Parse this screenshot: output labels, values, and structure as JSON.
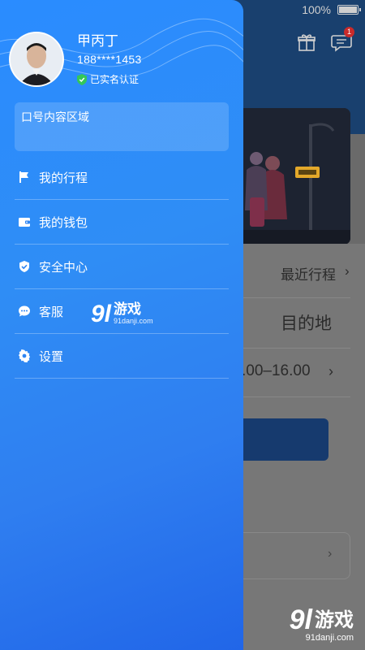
{
  "status_bar": {
    "battery_text": "100%"
  },
  "header": {
    "message_badge": "1"
  },
  "background": {
    "recent_trips_label": "最近行程",
    "recent_chevron": "›",
    "destination_label": "目的地",
    "time_range": ".00–16.00",
    "time_chevron": "›",
    "card_chevron": "›"
  },
  "drawer": {
    "user": {
      "name": "甲丙丁",
      "phone": "188****1453",
      "verified_label": "已实名认证"
    },
    "content_placeholder": "口号内容区域",
    "menu": [
      {
        "label": "我的行程",
        "icon": "flag-icon"
      },
      {
        "label": "我的钱包",
        "icon": "wallet-icon"
      },
      {
        "label": "安全中心",
        "icon": "shield-check-icon"
      },
      {
        "label": "客服",
        "icon": "chat-bubble-icon"
      },
      {
        "label": "设置",
        "icon": "gear-icon"
      }
    ]
  },
  "watermark": {
    "center_number": "9l",
    "center_text": "游戏",
    "center_url": "91danji.com",
    "corner_number": "9l",
    "corner_text": "游戏",
    "corner_url": "91danji.com"
  },
  "colors": {
    "drawer_gradient_start": "#2a8cff",
    "drawer_gradient_end": "#2166e8",
    "verified_green": "#34c759",
    "badge_red": "#c92a2a"
  }
}
